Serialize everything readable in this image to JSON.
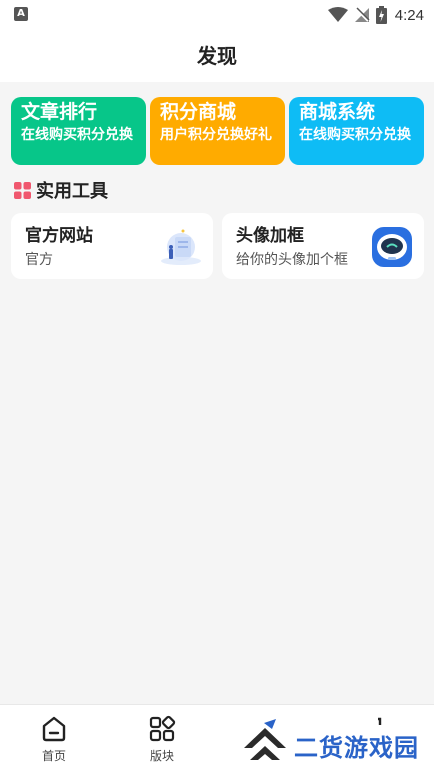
{
  "status_bar": {
    "time": "4:24",
    "app_icon_letter": "A"
  },
  "header": {
    "title": "发现"
  },
  "feature_cards": [
    {
      "title": "文章排行",
      "desc": "在线购买积分兑换",
      "color": "#07c689"
    },
    {
      "title": "积分商城",
      "desc": "用户积分兑换好礼",
      "color": "#ffab00"
    },
    {
      "title": "商城系统",
      "desc": "在线购买积分兑换",
      "color": "#0ebcf5"
    }
  ],
  "tools_section": {
    "title": "实用工具",
    "icon": "grid-icon",
    "icon_color": "#f0576e",
    "items": [
      {
        "title": "官方网站",
        "desc": "官方",
        "icon": "website-illustration"
      },
      {
        "title": "头像加框",
        "desc": "给你的头像加个框",
        "icon": "robot-avatar-icon"
      }
    ]
  },
  "tab_bar": {
    "tabs": [
      {
        "label": "首页",
        "icon": "home-icon"
      },
      {
        "label": "版块",
        "icon": "blocks-icon"
      }
    ]
  },
  "watermark": {
    "text": "二货游戏园"
  }
}
